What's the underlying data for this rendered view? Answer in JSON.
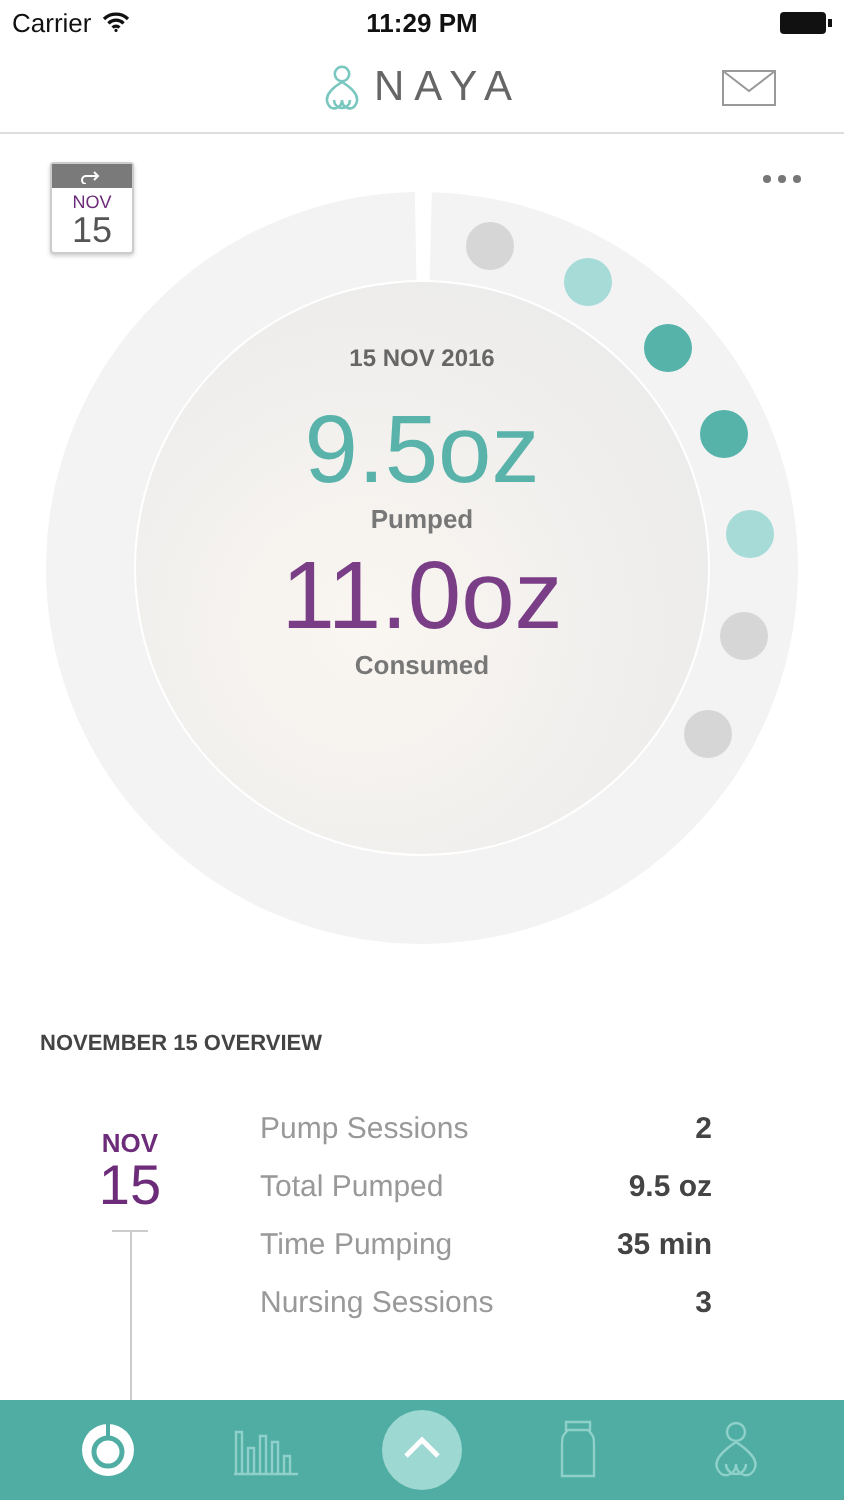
{
  "status_bar": {
    "carrier": "Carrier",
    "time": "11:29 PM"
  },
  "header": {
    "title": "NAYA"
  },
  "date_badge": {
    "month": "NOV",
    "day": "15"
  },
  "summary": {
    "date": "15 NOV 2016",
    "pumped_value": "9.5oz",
    "pumped_label": "Pumped",
    "consumed_value": "11.0oz",
    "consumed_label": "Consumed"
  },
  "sessions": [
    {
      "color": "#d6d6d6"
    },
    {
      "color": "#a6dbd8"
    },
    {
      "color": "#55b3aa"
    },
    {
      "color": "#55b3aa"
    },
    {
      "color": "#a6dbd8"
    },
    {
      "color": "#d6d6d6"
    },
    {
      "color": "#d6d6d6"
    }
  ],
  "overview": {
    "title": "NOVEMBER 15 OVERVIEW",
    "month": "NOV",
    "day": "15",
    "rows": [
      {
        "label": "Pump Sessions",
        "value": "2"
      },
      {
        "label": "Total Pumped",
        "value": "9.5 oz"
      },
      {
        "label": "Time Pumping",
        "value": "35 min"
      },
      {
        "label": "Nursing Sessions",
        "value": "3"
      }
    ]
  },
  "tab_bar": [
    {
      "kind": "ring",
      "selected": true
    },
    {
      "kind": "bars",
      "selected": false
    },
    {
      "kind": "up",
      "selected": false
    },
    {
      "kind": "bottle",
      "selected": false
    },
    {
      "kind": "figure",
      "selected": false
    }
  ]
}
